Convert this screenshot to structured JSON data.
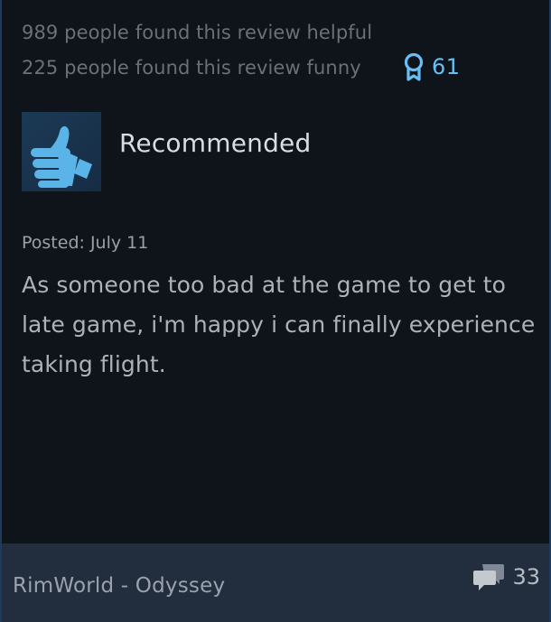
{
  "review": {
    "helpful_text": "989 people found this review helpful",
    "funny_text": "225 people found this review funny",
    "award_count": "61",
    "award_icon": "award-ribbon-icon",
    "recommendation": "Recommended",
    "recommendation_icon": "thumbs-up-icon",
    "posted": "Posted: July 11",
    "body": "As someone too bad at the game to get to late game, i'm happy i can finally experience taking flight."
  },
  "footer": {
    "game_title": "RimWorld - Odyssey",
    "comment_count": "33",
    "comment_icon": "comments-icon"
  },
  "colors": {
    "background": "#0f131a",
    "accent_blue": "#66c0f4",
    "footer_bg": "#222e3e",
    "thumb_blue": "#5ab4e8"
  }
}
